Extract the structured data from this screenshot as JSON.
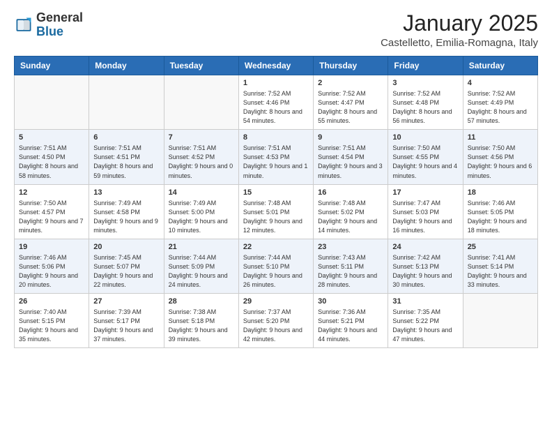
{
  "header": {
    "logo_general": "General",
    "logo_blue": "Blue",
    "month_title": "January 2025",
    "location": "Castelletto, Emilia-Romagna, Italy"
  },
  "weekdays": [
    "Sunday",
    "Monday",
    "Tuesday",
    "Wednesday",
    "Thursday",
    "Friday",
    "Saturday"
  ],
  "weeks": [
    [
      {
        "day": "",
        "sunrise": "",
        "sunset": "",
        "daylight": ""
      },
      {
        "day": "",
        "sunrise": "",
        "sunset": "",
        "daylight": ""
      },
      {
        "day": "",
        "sunrise": "",
        "sunset": "",
        "daylight": ""
      },
      {
        "day": "1",
        "sunrise": "Sunrise: 7:52 AM",
        "sunset": "Sunset: 4:46 PM",
        "daylight": "Daylight: 8 hours and 54 minutes."
      },
      {
        "day": "2",
        "sunrise": "Sunrise: 7:52 AM",
        "sunset": "Sunset: 4:47 PM",
        "daylight": "Daylight: 8 hours and 55 minutes."
      },
      {
        "day": "3",
        "sunrise": "Sunrise: 7:52 AM",
        "sunset": "Sunset: 4:48 PM",
        "daylight": "Daylight: 8 hours and 56 minutes."
      },
      {
        "day": "4",
        "sunrise": "Sunrise: 7:52 AM",
        "sunset": "Sunset: 4:49 PM",
        "daylight": "Daylight: 8 hours and 57 minutes."
      }
    ],
    [
      {
        "day": "5",
        "sunrise": "Sunrise: 7:51 AM",
        "sunset": "Sunset: 4:50 PM",
        "daylight": "Daylight: 8 hours and 58 minutes."
      },
      {
        "day": "6",
        "sunrise": "Sunrise: 7:51 AM",
        "sunset": "Sunset: 4:51 PM",
        "daylight": "Daylight: 8 hours and 59 minutes."
      },
      {
        "day": "7",
        "sunrise": "Sunrise: 7:51 AM",
        "sunset": "Sunset: 4:52 PM",
        "daylight": "Daylight: 9 hours and 0 minutes."
      },
      {
        "day": "8",
        "sunrise": "Sunrise: 7:51 AM",
        "sunset": "Sunset: 4:53 PM",
        "daylight": "Daylight: 9 hours and 1 minute."
      },
      {
        "day": "9",
        "sunrise": "Sunrise: 7:51 AM",
        "sunset": "Sunset: 4:54 PM",
        "daylight": "Daylight: 9 hours and 3 minutes."
      },
      {
        "day": "10",
        "sunrise": "Sunrise: 7:50 AM",
        "sunset": "Sunset: 4:55 PM",
        "daylight": "Daylight: 9 hours and 4 minutes."
      },
      {
        "day": "11",
        "sunrise": "Sunrise: 7:50 AM",
        "sunset": "Sunset: 4:56 PM",
        "daylight": "Daylight: 9 hours and 6 minutes."
      }
    ],
    [
      {
        "day": "12",
        "sunrise": "Sunrise: 7:50 AM",
        "sunset": "Sunset: 4:57 PM",
        "daylight": "Daylight: 9 hours and 7 minutes."
      },
      {
        "day": "13",
        "sunrise": "Sunrise: 7:49 AM",
        "sunset": "Sunset: 4:58 PM",
        "daylight": "Daylight: 9 hours and 9 minutes."
      },
      {
        "day": "14",
        "sunrise": "Sunrise: 7:49 AM",
        "sunset": "Sunset: 5:00 PM",
        "daylight": "Daylight: 9 hours and 10 minutes."
      },
      {
        "day": "15",
        "sunrise": "Sunrise: 7:48 AM",
        "sunset": "Sunset: 5:01 PM",
        "daylight": "Daylight: 9 hours and 12 minutes."
      },
      {
        "day": "16",
        "sunrise": "Sunrise: 7:48 AM",
        "sunset": "Sunset: 5:02 PM",
        "daylight": "Daylight: 9 hours and 14 minutes."
      },
      {
        "day": "17",
        "sunrise": "Sunrise: 7:47 AM",
        "sunset": "Sunset: 5:03 PM",
        "daylight": "Daylight: 9 hours and 16 minutes."
      },
      {
        "day": "18",
        "sunrise": "Sunrise: 7:46 AM",
        "sunset": "Sunset: 5:05 PM",
        "daylight": "Daylight: 9 hours and 18 minutes."
      }
    ],
    [
      {
        "day": "19",
        "sunrise": "Sunrise: 7:46 AM",
        "sunset": "Sunset: 5:06 PM",
        "daylight": "Daylight: 9 hours and 20 minutes."
      },
      {
        "day": "20",
        "sunrise": "Sunrise: 7:45 AM",
        "sunset": "Sunset: 5:07 PM",
        "daylight": "Daylight: 9 hours and 22 minutes."
      },
      {
        "day": "21",
        "sunrise": "Sunrise: 7:44 AM",
        "sunset": "Sunset: 5:09 PM",
        "daylight": "Daylight: 9 hours and 24 minutes."
      },
      {
        "day": "22",
        "sunrise": "Sunrise: 7:44 AM",
        "sunset": "Sunset: 5:10 PM",
        "daylight": "Daylight: 9 hours and 26 minutes."
      },
      {
        "day": "23",
        "sunrise": "Sunrise: 7:43 AM",
        "sunset": "Sunset: 5:11 PM",
        "daylight": "Daylight: 9 hours and 28 minutes."
      },
      {
        "day": "24",
        "sunrise": "Sunrise: 7:42 AM",
        "sunset": "Sunset: 5:13 PM",
        "daylight": "Daylight: 9 hours and 30 minutes."
      },
      {
        "day": "25",
        "sunrise": "Sunrise: 7:41 AM",
        "sunset": "Sunset: 5:14 PM",
        "daylight": "Daylight: 9 hours and 33 minutes."
      }
    ],
    [
      {
        "day": "26",
        "sunrise": "Sunrise: 7:40 AM",
        "sunset": "Sunset: 5:15 PM",
        "daylight": "Daylight: 9 hours and 35 minutes."
      },
      {
        "day": "27",
        "sunrise": "Sunrise: 7:39 AM",
        "sunset": "Sunset: 5:17 PM",
        "daylight": "Daylight: 9 hours and 37 minutes."
      },
      {
        "day": "28",
        "sunrise": "Sunrise: 7:38 AM",
        "sunset": "Sunset: 5:18 PM",
        "daylight": "Daylight: 9 hours and 39 minutes."
      },
      {
        "day": "29",
        "sunrise": "Sunrise: 7:37 AM",
        "sunset": "Sunset: 5:20 PM",
        "daylight": "Daylight: 9 hours and 42 minutes."
      },
      {
        "day": "30",
        "sunrise": "Sunrise: 7:36 AM",
        "sunset": "Sunset: 5:21 PM",
        "daylight": "Daylight: 9 hours and 44 minutes."
      },
      {
        "day": "31",
        "sunrise": "Sunrise: 7:35 AM",
        "sunset": "Sunset: 5:22 PM",
        "daylight": "Daylight: 9 hours and 47 minutes."
      },
      {
        "day": "",
        "sunrise": "",
        "sunset": "",
        "daylight": ""
      }
    ]
  ]
}
